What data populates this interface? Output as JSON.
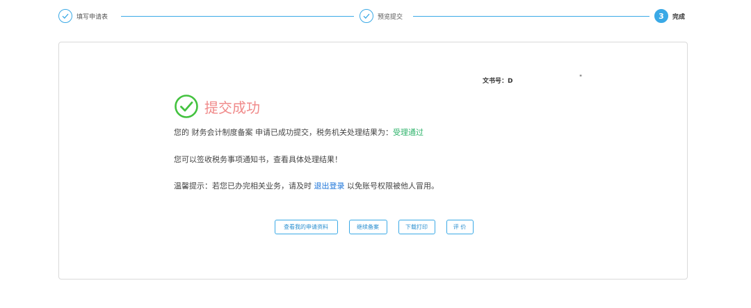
{
  "steps": [
    {
      "label": "填写申请表",
      "state": "done"
    },
    {
      "label": "预览提交",
      "state": "done"
    },
    {
      "number": "3",
      "label": "完成",
      "state": "active"
    }
  ],
  "doc": {
    "label": "文书号：D",
    "mark": "\""
  },
  "result": {
    "title": "提交成功",
    "line1_prefix": "您的 财务会计制度备案 申请已成功提交，税务机关处理结果为：",
    "line1_status": "受理通过",
    "line2": "您可以签收税务事项通知书，查看具体处理结果！",
    "line3_prefix": "温馨提示：若您已办完相关业务，请及时 ",
    "line3_link": "退出登录",
    "line3_suffix": " 以免账号权限被他人冒用。"
  },
  "buttons": {
    "view": "查看我的申请资料",
    "continue": "继续备案",
    "download": "下载打印",
    "rate": "评 价"
  },
  "colors": {
    "accent": "#3aa9e6",
    "success_green": "#2fb36b",
    "title_pink": "#f08a8a",
    "link_blue": "#1a73d9"
  }
}
